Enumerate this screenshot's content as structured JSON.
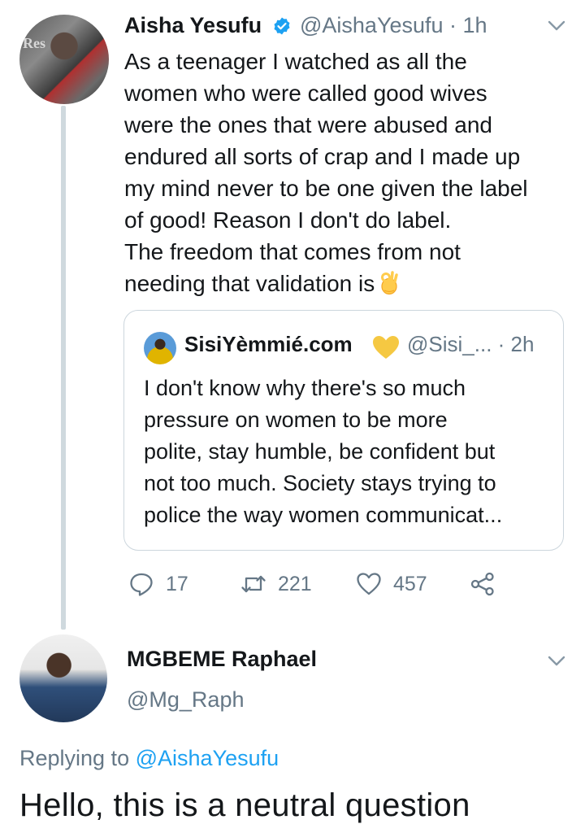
{
  "tweet": {
    "author_name": "Aisha Yesufu",
    "author_handle": "@AishaYesufu",
    "time": "· 1h",
    "avatar_text": "Res",
    "body_lines": [
      "As a teenager I watched as all the",
      "women who were called good wives",
      "were the ones that were abused and",
      "endured all sorts of crap and I made up",
      "my mind never to be one given the label",
      "of good! Reason I don't do label.",
      "The freedom that comes from not",
      "needing that validation is"
    ],
    "emoji": "ok-hand-emoji",
    "quoted": {
      "author_name": "SisiYèmmié.com",
      "author_handle": "@Sisi_...",
      "time": "· 2h",
      "body_lines": [
        "I don't know why there's so much",
        "pressure on women to be more",
        "polite, stay humble, be confident but",
        "not too much. Society stays trying to",
        "police the way women communicat..."
      ]
    },
    "actions": {
      "reply_count": "17",
      "retweet_count": "221",
      "like_count": "457"
    }
  },
  "reply": {
    "author_name": "MGBEME Raphael",
    "author_handle": "@Mg_Raph",
    "replying_prefix": "Replying to",
    "replying_to": "@AishaYesufu",
    "body": "Hello, this is a neutral question"
  },
  "colors": {
    "text": "#14171a",
    "secondary": "#657786",
    "link": "#1da1f2",
    "thread_line": "#cfd9de",
    "border": "#ccd6dd",
    "heart_gold": "#f5c842"
  }
}
